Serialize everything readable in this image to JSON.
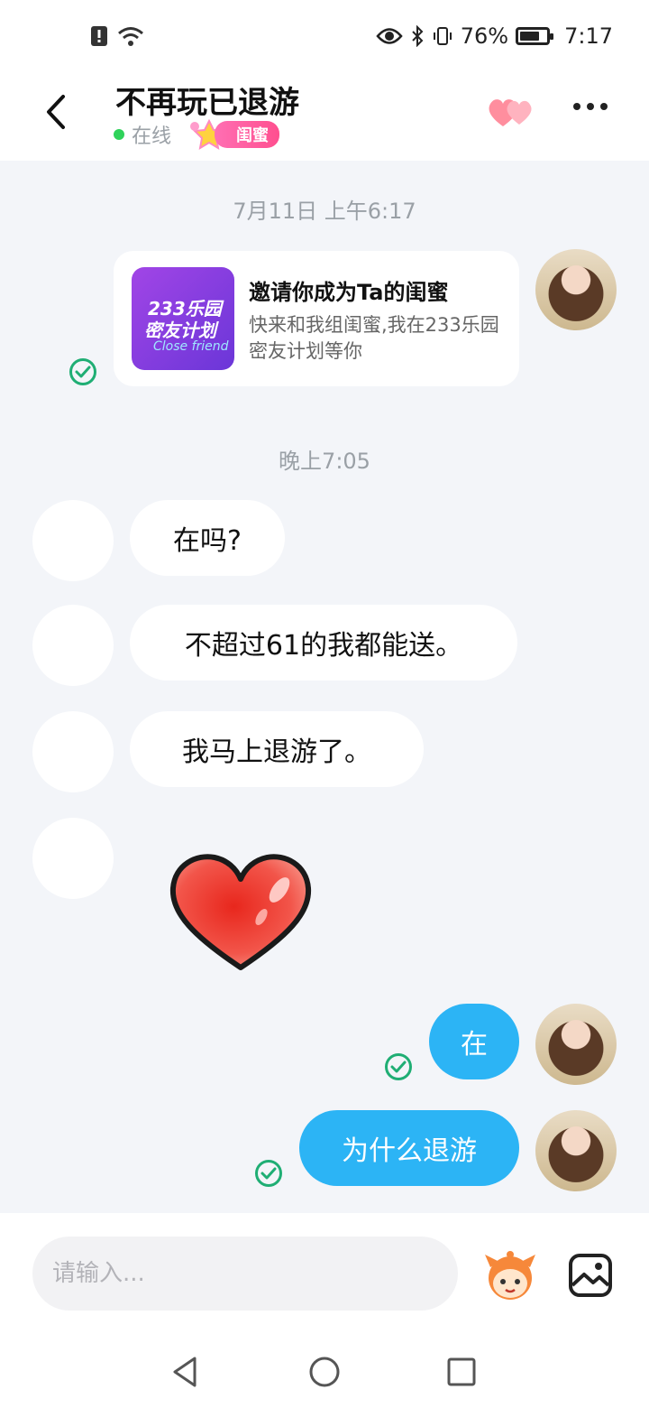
{
  "status_bar": {
    "battery_percent": "76%",
    "battery_level": 0.76,
    "time": "7:17"
  },
  "header": {
    "title": "不再玩已退游",
    "status": "在线",
    "badge": "闺蜜"
  },
  "messages": {
    "timestamp_1": "7月11日 上午6:17",
    "invite_card": {
      "title": "邀请你成为Ta的闺蜜",
      "description": "快来和我组闺蜜,我在233乐园密友计划等你",
      "image_line1": "233乐园",
      "image_line2": "密友计划",
      "image_line3": "Close friend"
    },
    "timestamp_2": "晚上7:05",
    "incoming": [
      "在吗?",
      "不超过61的我都能送。",
      "我马上退游了。"
    ],
    "outgoing": [
      "在",
      "为什么退游"
    ]
  },
  "input": {
    "placeholder": "请输入..."
  },
  "colors": {
    "accent_blue": "#2cb4f5",
    "online_green": "#2fd25a",
    "badge_pink": "#ff4f8f",
    "check_green": "#1fae74"
  }
}
